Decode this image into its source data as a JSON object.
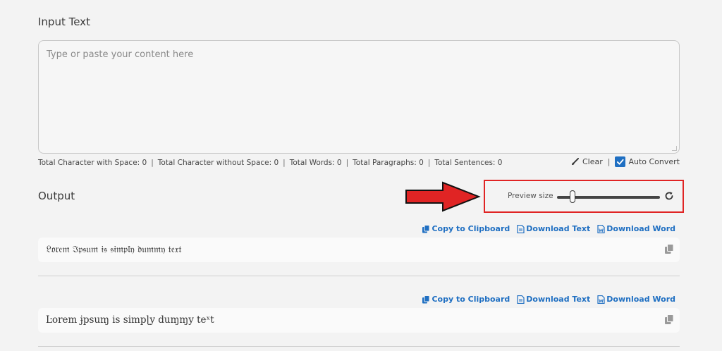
{
  "input": {
    "title": "Input Text",
    "placeholder": "Type or paste your content here",
    "value": ""
  },
  "stats": {
    "chars_with_space": "Total Character with Space: 0",
    "chars_without_space": "Total Character without Space: 0",
    "words": "Total Words: 0",
    "paragraphs": "Total Paragraphs: 0",
    "sentences": "Total Sentences: 0",
    "separator": "|"
  },
  "controls": {
    "clear_label": "Clear",
    "auto_convert_label": "Auto Convert",
    "auto_convert_checked": true
  },
  "output": {
    "title": "Output",
    "preview_label": "Preview size",
    "preview_level": 0.15,
    "actions": {
      "copy_label": "Copy to Clipboard",
      "download_text_label": "Download Text",
      "download_word_label": "Download Word"
    },
    "results": [
      {
        "text": "𝔏𝔬𝔯𝔢𝔪 ℑ𝔭𝔰𝔲𝔪 𝔦𝔰 𝔰𝔦𝔪𝔭𝔩𝔶 𝔡𝔲𝔪𝔪𝔶 𝔱𝔢𝔵𝔱"
      },
      {
        "text": "Ŀorem ɉpsuɱ is simpɭy duɱɱy teˣt"
      }
    ]
  },
  "annotation": {
    "arrow_color": "#e02424",
    "highlight_color": "#e02424"
  },
  "colors": {
    "accent": "#1f6fc2",
    "background": "#f3f3f3"
  }
}
